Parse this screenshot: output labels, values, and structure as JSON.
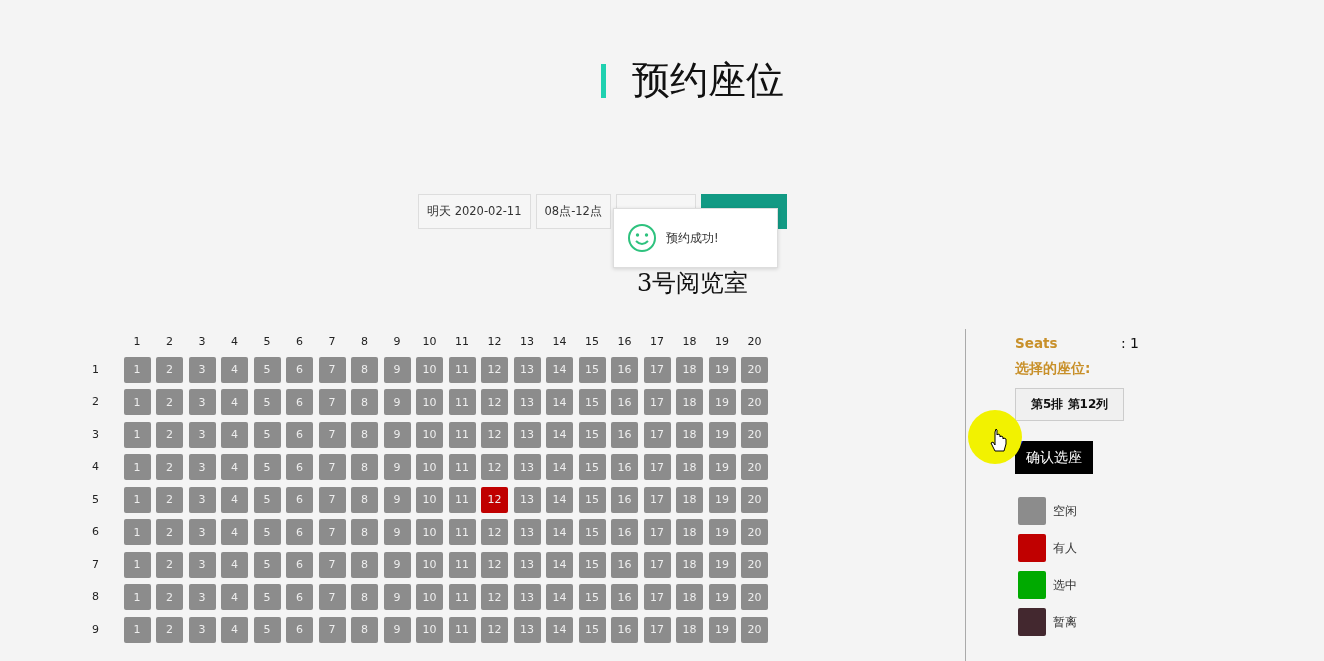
{
  "title": "预约座位",
  "toolbar": {
    "date": "明天 2020-02-11",
    "time": "08点-12点"
  },
  "toast": {
    "message": "预约成功!"
  },
  "room_title": "3号阅览室",
  "seat_map": {
    "columns": [
      "1",
      "2",
      "3",
      "4",
      "5",
      "6",
      "7",
      "8",
      "9",
      "10",
      "11",
      "12",
      "13",
      "14",
      "15",
      "16",
      "17",
      "18",
      "19",
      "20"
    ],
    "rows": [
      {
        "label": "1",
        "seats": [
          {
            "number": "1",
            "occupied": false
          },
          {
            "number": "2",
            "occupied": false
          },
          {
            "number": "3",
            "occupied": false
          },
          {
            "number": "4",
            "occupied": false
          },
          {
            "number": "5",
            "occupied": false
          },
          {
            "number": "6",
            "occupied": false
          },
          {
            "number": "7",
            "occupied": false
          },
          {
            "number": "8",
            "occupied": false
          },
          {
            "number": "9",
            "occupied": false
          },
          {
            "number": "10",
            "occupied": false
          },
          {
            "number": "11",
            "occupied": false
          },
          {
            "number": "12",
            "occupied": false
          },
          {
            "number": "13",
            "occupied": false
          },
          {
            "number": "14",
            "occupied": false
          },
          {
            "number": "15",
            "occupied": false
          },
          {
            "number": "16",
            "occupied": false
          },
          {
            "number": "17",
            "occupied": false
          },
          {
            "number": "18",
            "occupied": false
          },
          {
            "number": "19",
            "occupied": false
          },
          {
            "number": "20",
            "occupied": false
          }
        ]
      },
      {
        "label": "2",
        "seats": [
          {
            "number": "1",
            "occupied": false
          },
          {
            "number": "2",
            "occupied": false
          },
          {
            "number": "3",
            "occupied": false
          },
          {
            "number": "4",
            "occupied": false
          },
          {
            "number": "5",
            "occupied": false
          },
          {
            "number": "6",
            "occupied": false
          },
          {
            "number": "7",
            "occupied": false
          },
          {
            "number": "8",
            "occupied": false
          },
          {
            "number": "9",
            "occupied": false
          },
          {
            "number": "10",
            "occupied": false
          },
          {
            "number": "11",
            "occupied": false
          },
          {
            "number": "12",
            "occupied": false
          },
          {
            "number": "13",
            "occupied": false
          },
          {
            "number": "14",
            "occupied": false
          },
          {
            "number": "15",
            "occupied": false
          },
          {
            "number": "16",
            "occupied": false
          },
          {
            "number": "17",
            "occupied": false
          },
          {
            "number": "18",
            "occupied": false
          },
          {
            "number": "19",
            "occupied": false
          },
          {
            "number": "20",
            "occupied": false
          }
        ]
      },
      {
        "label": "3",
        "seats": [
          {
            "number": "1",
            "occupied": false
          },
          {
            "number": "2",
            "occupied": false
          },
          {
            "number": "3",
            "occupied": false
          },
          {
            "number": "4",
            "occupied": false
          },
          {
            "number": "5",
            "occupied": false
          },
          {
            "number": "6",
            "occupied": false
          },
          {
            "number": "7",
            "occupied": false
          },
          {
            "number": "8",
            "occupied": false
          },
          {
            "number": "9",
            "occupied": false
          },
          {
            "number": "10",
            "occupied": false
          },
          {
            "number": "11",
            "occupied": false
          },
          {
            "number": "12",
            "occupied": false
          },
          {
            "number": "13",
            "occupied": false
          },
          {
            "number": "14",
            "occupied": false
          },
          {
            "number": "15",
            "occupied": false
          },
          {
            "number": "16",
            "occupied": false
          },
          {
            "number": "17",
            "occupied": false
          },
          {
            "number": "18",
            "occupied": false
          },
          {
            "number": "19",
            "occupied": false
          },
          {
            "number": "20",
            "occupied": false
          }
        ]
      },
      {
        "label": "4",
        "seats": [
          {
            "number": "1",
            "occupied": false
          },
          {
            "number": "2",
            "occupied": false
          },
          {
            "number": "3",
            "occupied": false
          },
          {
            "number": "4",
            "occupied": false
          },
          {
            "number": "5",
            "occupied": false
          },
          {
            "number": "6",
            "occupied": false
          },
          {
            "number": "7",
            "occupied": false
          },
          {
            "number": "8",
            "occupied": false
          },
          {
            "number": "9",
            "occupied": false
          },
          {
            "number": "10",
            "occupied": false
          },
          {
            "number": "11",
            "occupied": false
          },
          {
            "number": "12",
            "occupied": false
          },
          {
            "number": "13",
            "occupied": false
          },
          {
            "number": "14",
            "occupied": false
          },
          {
            "number": "15",
            "occupied": false
          },
          {
            "number": "16",
            "occupied": false
          },
          {
            "number": "17",
            "occupied": false
          },
          {
            "number": "18",
            "occupied": false
          },
          {
            "number": "19",
            "occupied": false
          },
          {
            "number": "20",
            "occupied": false
          }
        ]
      },
      {
        "label": "5",
        "seats": [
          {
            "number": "1",
            "occupied": false
          },
          {
            "number": "2",
            "occupied": false
          },
          {
            "number": "3",
            "occupied": false
          },
          {
            "number": "4",
            "occupied": false
          },
          {
            "number": "5",
            "occupied": false
          },
          {
            "number": "6",
            "occupied": false
          },
          {
            "number": "7",
            "occupied": false
          },
          {
            "number": "8",
            "occupied": false
          },
          {
            "number": "9",
            "occupied": false
          },
          {
            "number": "10",
            "occupied": false
          },
          {
            "number": "11",
            "occupied": false
          },
          {
            "number": "12",
            "occupied": true
          },
          {
            "number": "13",
            "occupied": false
          },
          {
            "number": "14",
            "occupied": false
          },
          {
            "number": "15",
            "occupied": false
          },
          {
            "number": "16",
            "occupied": false
          },
          {
            "number": "17",
            "occupied": false
          },
          {
            "number": "18",
            "occupied": false
          },
          {
            "number": "19",
            "occupied": false
          },
          {
            "number": "20",
            "occupied": false
          }
        ]
      },
      {
        "label": "6",
        "seats": [
          {
            "number": "1",
            "occupied": false
          },
          {
            "number": "2",
            "occupied": false
          },
          {
            "number": "3",
            "occupied": false
          },
          {
            "number": "4",
            "occupied": false
          },
          {
            "number": "5",
            "occupied": false
          },
          {
            "number": "6",
            "occupied": false
          },
          {
            "number": "7",
            "occupied": false
          },
          {
            "number": "8",
            "occupied": false
          },
          {
            "number": "9",
            "occupied": false
          },
          {
            "number": "10",
            "occupied": false
          },
          {
            "number": "11",
            "occupied": false
          },
          {
            "number": "12",
            "occupied": false
          },
          {
            "number": "13",
            "occupied": false
          },
          {
            "number": "14",
            "occupied": false
          },
          {
            "number": "15",
            "occupied": false
          },
          {
            "number": "16",
            "occupied": false
          },
          {
            "number": "17",
            "occupied": false
          },
          {
            "number": "18",
            "occupied": false
          },
          {
            "number": "19",
            "occupied": false
          },
          {
            "number": "20",
            "occupied": false
          }
        ]
      },
      {
        "label": "7",
        "seats": [
          {
            "number": "1",
            "occupied": false
          },
          {
            "number": "2",
            "occupied": false
          },
          {
            "number": "3",
            "occupied": false
          },
          {
            "number": "4",
            "occupied": false
          },
          {
            "number": "5",
            "occupied": false
          },
          {
            "number": "6",
            "occupied": false
          },
          {
            "number": "7",
            "occupied": false
          },
          {
            "number": "8",
            "occupied": false
          },
          {
            "number": "9",
            "occupied": false
          },
          {
            "number": "10",
            "occupied": false
          },
          {
            "number": "11",
            "occupied": false
          },
          {
            "number": "12",
            "occupied": false
          },
          {
            "number": "13",
            "occupied": false
          },
          {
            "number": "14",
            "occupied": false
          },
          {
            "number": "15",
            "occupied": false
          },
          {
            "number": "16",
            "occupied": false
          },
          {
            "number": "17",
            "occupied": false
          },
          {
            "number": "18",
            "occupied": false
          },
          {
            "number": "19",
            "occupied": false
          },
          {
            "number": "20",
            "occupied": false
          }
        ]
      },
      {
        "label": "8",
        "seats": [
          {
            "number": "1",
            "occupied": false
          },
          {
            "number": "2",
            "occupied": false
          },
          {
            "number": "3",
            "occupied": false
          },
          {
            "number": "4",
            "occupied": false
          },
          {
            "number": "5",
            "occupied": false
          },
          {
            "number": "6",
            "occupied": false
          },
          {
            "number": "7",
            "occupied": false
          },
          {
            "number": "8",
            "occupied": false
          },
          {
            "number": "9",
            "occupied": false
          },
          {
            "number": "10",
            "occupied": false
          },
          {
            "number": "11",
            "occupied": false
          },
          {
            "number": "12",
            "occupied": false
          },
          {
            "number": "13",
            "occupied": false
          },
          {
            "number": "14",
            "occupied": false
          },
          {
            "number": "15",
            "occupied": false
          },
          {
            "number": "16",
            "occupied": false
          },
          {
            "number": "17",
            "occupied": false
          },
          {
            "number": "18",
            "occupied": false
          },
          {
            "number": "19",
            "occupied": false
          },
          {
            "number": "20",
            "occupied": false
          }
        ]
      },
      {
        "label": "9",
        "seats": [
          {
            "number": "1",
            "occupied": false
          },
          {
            "number": "2",
            "occupied": false
          },
          {
            "number": "3",
            "occupied": false
          },
          {
            "number": "4",
            "occupied": false
          },
          {
            "number": "5",
            "occupied": false
          },
          {
            "number": "6",
            "occupied": false
          },
          {
            "number": "7",
            "occupied": false
          },
          {
            "number": "8",
            "occupied": false
          },
          {
            "number": "9",
            "occupied": false
          },
          {
            "number": "10",
            "occupied": false
          },
          {
            "number": "11",
            "occupied": false
          },
          {
            "number": "12",
            "occupied": false
          },
          {
            "number": "13",
            "occupied": false
          },
          {
            "number": "14",
            "occupied": false
          },
          {
            "number": "15",
            "occupied": false
          },
          {
            "number": "16",
            "occupied": false
          },
          {
            "number": "17",
            "occupied": false
          },
          {
            "number": "18",
            "occupied": false
          },
          {
            "number": "19",
            "occupied": false
          },
          {
            "number": "20",
            "occupied": false
          }
        ]
      }
    ]
  },
  "side_panel": {
    "seats_label": "Seats",
    "seats_count": ": 1",
    "selected_label": "选择的座位:",
    "selected_seat": "第5排 第12列",
    "confirm_button": "确认选座",
    "legend": [
      {
        "label": "空闲",
        "color": "#8c8c8c"
      },
      {
        "label": "有人",
        "color": "#c00000"
      },
      {
        "label": "选中",
        "color": "#00aa00"
      },
      {
        "label": "暂离",
        "color": "#43282f"
      }
    ]
  }
}
